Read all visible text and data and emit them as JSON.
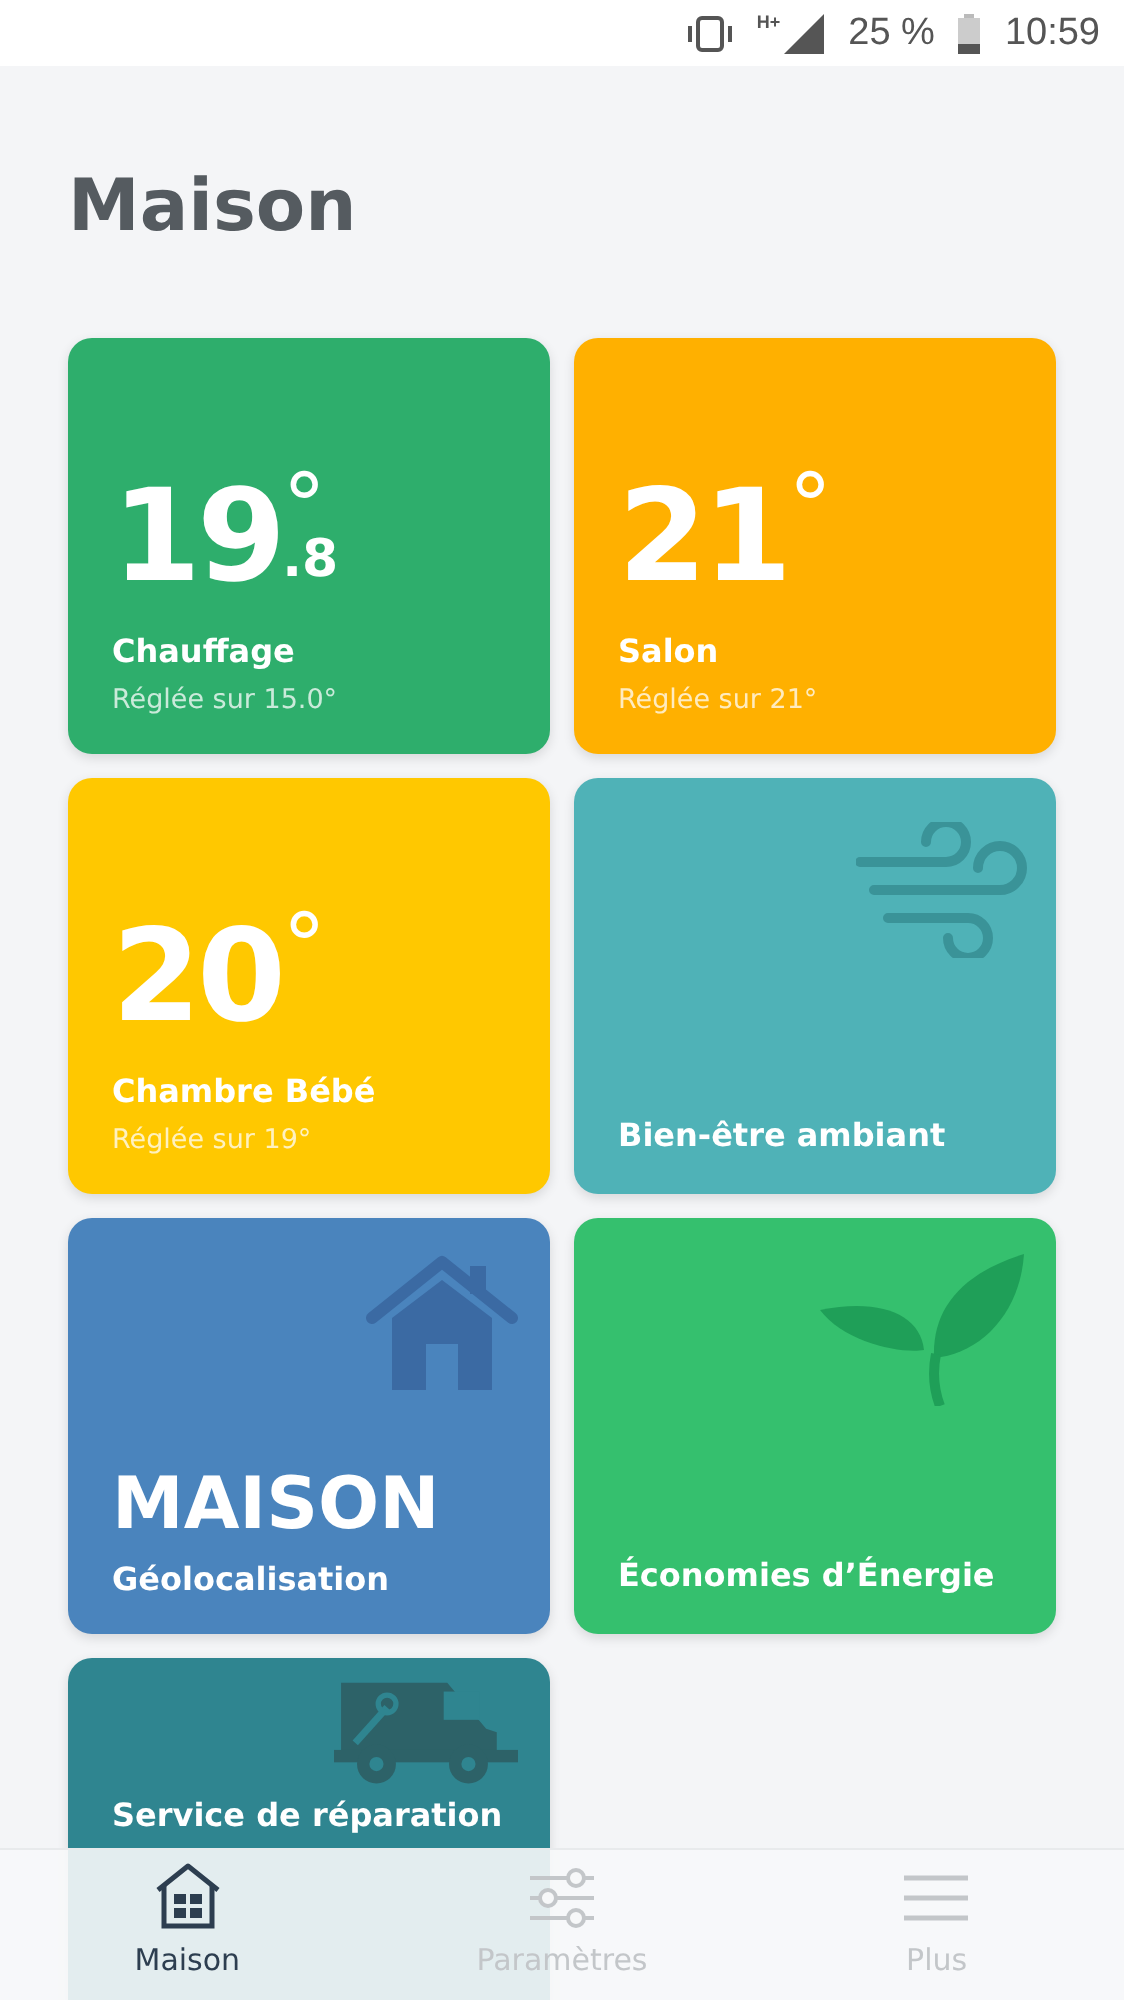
{
  "status_bar": {
    "network": "H+",
    "battery": "25 %",
    "time": "10:59"
  },
  "title": "Maison",
  "cards": [
    {
      "kind": "thermostat",
      "color": "#2eae6c",
      "temp": {
        "whole": "19",
        "fraction": ".8",
        "unit": "°"
      },
      "name": "Chauffage",
      "setpoint": "Réglée sur 15.0°"
    },
    {
      "kind": "thermostat",
      "color": "#ffb000",
      "temp": {
        "whole": "21",
        "unit": "°"
      },
      "name": "Salon",
      "setpoint": "Réglée sur 21°"
    },
    {
      "kind": "thermostat",
      "color": "#ffc800",
      "temp": {
        "whole": "20",
        "unit": "°"
      },
      "name": "Chambre Bébé",
      "setpoint": "Réglée sur 19°"
    },
    {
      "kind": "air",
      "color": "#4fb2b7",
      "name": "Bien-être ambiant"
    },
    {
      "kind": "location",
      "color": "#4a84bd",
      "big": "MAISON",
      "name": "Géolocalisation"
    },
    {
      "kind": "energy",
      "color": "#35c06e",
      "name": "Économies d’Énergie"
    },
    {
      "kind": "repair",
      "color": "#2f8590",
      "name": "Service de réparation"
    }
  ],
  "nav": [
    {
      "kind": "home",
      "label": "Maison",
      "selected": true
    },
    {
      "kind": "settings",
      "label": "Paramètres",
      "selected": false
    },
    {
      "kind": "menu",
      "label": "Plus",
      "selected": false
    }
  ]
}
